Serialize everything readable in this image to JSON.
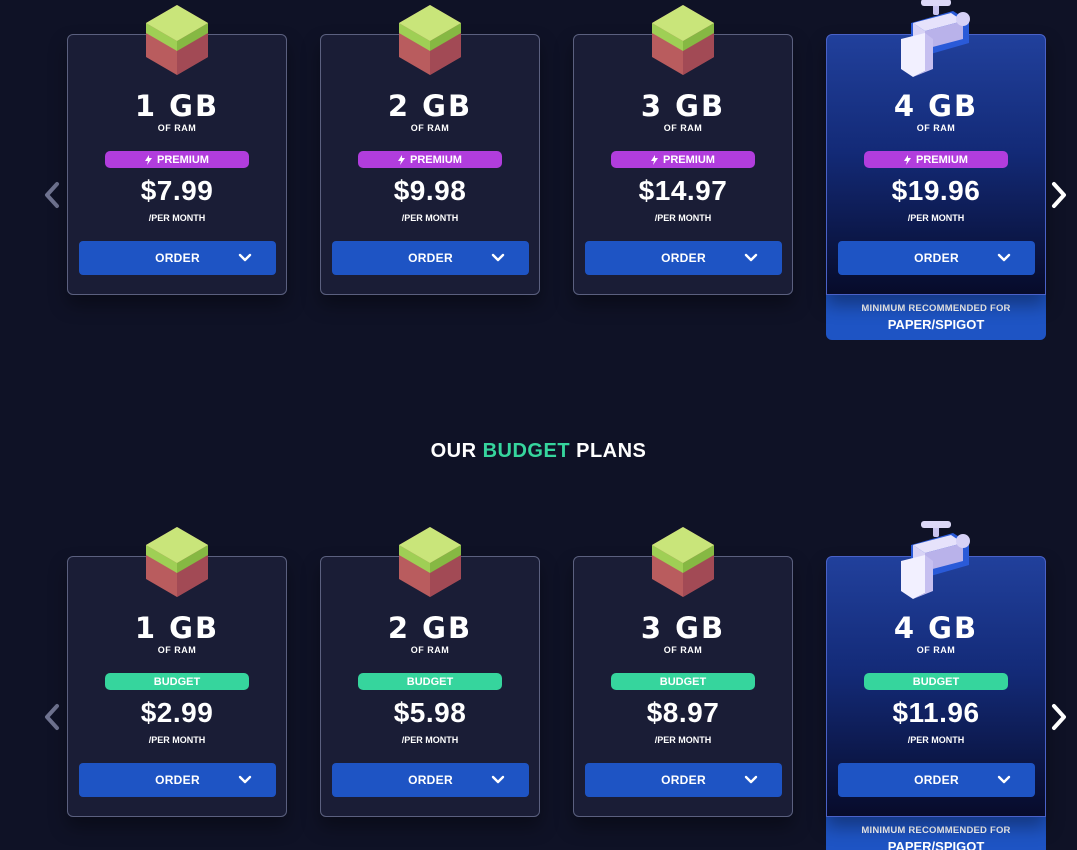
{
  "colors": {
    "background": "#0f1226",
    "card": "#1a1d36",
    "accent_blue": "#1e54c4",
    "premium_purple": "#b13ddd",
    "budget_green": "#36d59d"
  },
  "premium_section": {
    "plans": [
      {
        "ram": "1 GB",
        "ram_sub": "OF RAM",
        "badge": "PREMIUM",
        "price": "$7.99",
        "per": "/PER MONTH",
        "order": "ORDER",
        "icon": "grass-block-icon"
      },
      {
        "ram": "2 GB",
        "ram_sub": "OF RAM",
        "badge": "PREMIUM",
        "price": "$9.98",
        "per": "/PER MONTH",
        "order": "ORDER",
        "icon": "grass-block-icon"
      },
      {
        "ram": "3 GB",
        "ram_sub": "OF RAM",
        "badge": "PREMIUM",
        "price": "$14.97",
        "per": "/PER MONTH",
        "order": "ORDER",
        "icon": "grass-block-icon"
      },
      {
        "ram": "4 GB",
        "ram_sub": "OF RAM",
        "badge": "PREMIUM",
        "price": "$19.96",
        "per": "/PER MONTH",
        "order": "ORDER",
        "icon": "water-tap-icon",
        "recommended_line1": "MINIMUM RECOMMENDED FOR",
        "recommended_line2": "PAPER/SPIGOT"
      }
    ]
  },
  "budget_heading": {
    "prefix": "OUR",
    "accent": "BUDGET",
    "suffix": "PLANS"
  },
  "budget_section": {
    "plans": [
      {
        "ram": "1 GB",
        "ram_sub": "OF RAM",
        "badge": "BUDGET",
        "price": "$2.99",
        "per": "/PER MONTH",
        "order": "ORDER",
        "icon": "grass-block-icon"
      },
      {
        "ram": "2 GB",
        "ram_sub": "OF RAM",
        "badge": "BUDGET",
        "price": "$5.98",
        "per": "/PER MONTH",
        "order": "ORDER",
        "icon": "grass-block-icon"
      },
      {
        "ram": "3 GB",
        "ram_sub": "OF RAM",
        "badge": "BUDGET",
        "price": "$8.97",
        "per": "/PER MONTH",
        "order": "ORDER",
        "icon": "grass-block-icon"
      },
      {
        "ram": "4 GB",
        "ram_sub": "OF RAM",
        "badge": "BUDGET",
        "price": "$11.96",
        "per": "/PER MONTH",
        "order": "ORDER",
        "icon": "water-tap-icon",
        "recommended_line1": "MINIMUM RECOMMENDED FOR",
        "recommended_line2": "PAPER/SPIGOT"
      }
    ]
  }
}
